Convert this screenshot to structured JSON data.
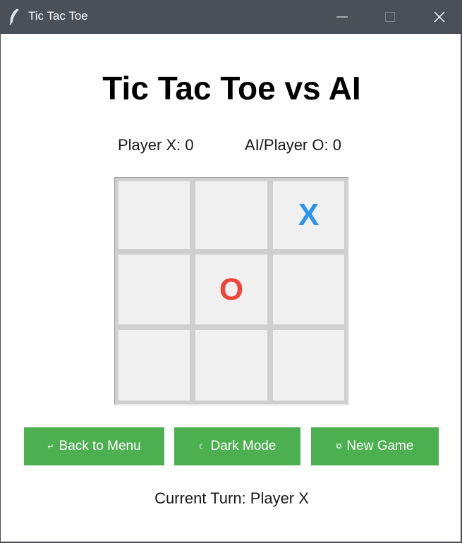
{
  "window": {
    "title": "Tic Tac Toe",
    "icon": "feather-icon"
  },
  "game": {
    "heading": "Tic Tac Toe vs AI",
    "score_x": "Player X: 0",
    "score_o": "AI/Player O: 0",
    "board": [
      "",
      "",
      "X",
      "",
      "O",
      "",
      "",
      "",
      ""
    ],
    "current_turn": "Current Turn: Player X"
  },
  "buttons": {
    "back": {
      "label": "Back to Menu",
      "icon": "↵"
    },
    "dark": {
      "label": "Dark Mode",
      "icon": "☾"
    },
    "new_game": {
      "label": "New Game",
      "icon": "⧉"
    }
  },
  "colors": {
    "accent_button": "#4caf50",
    "x_mark": "#2a95f0",
    "o_mark": "#f0453a",
    "titlebar": "#4a5056"
  }
}
